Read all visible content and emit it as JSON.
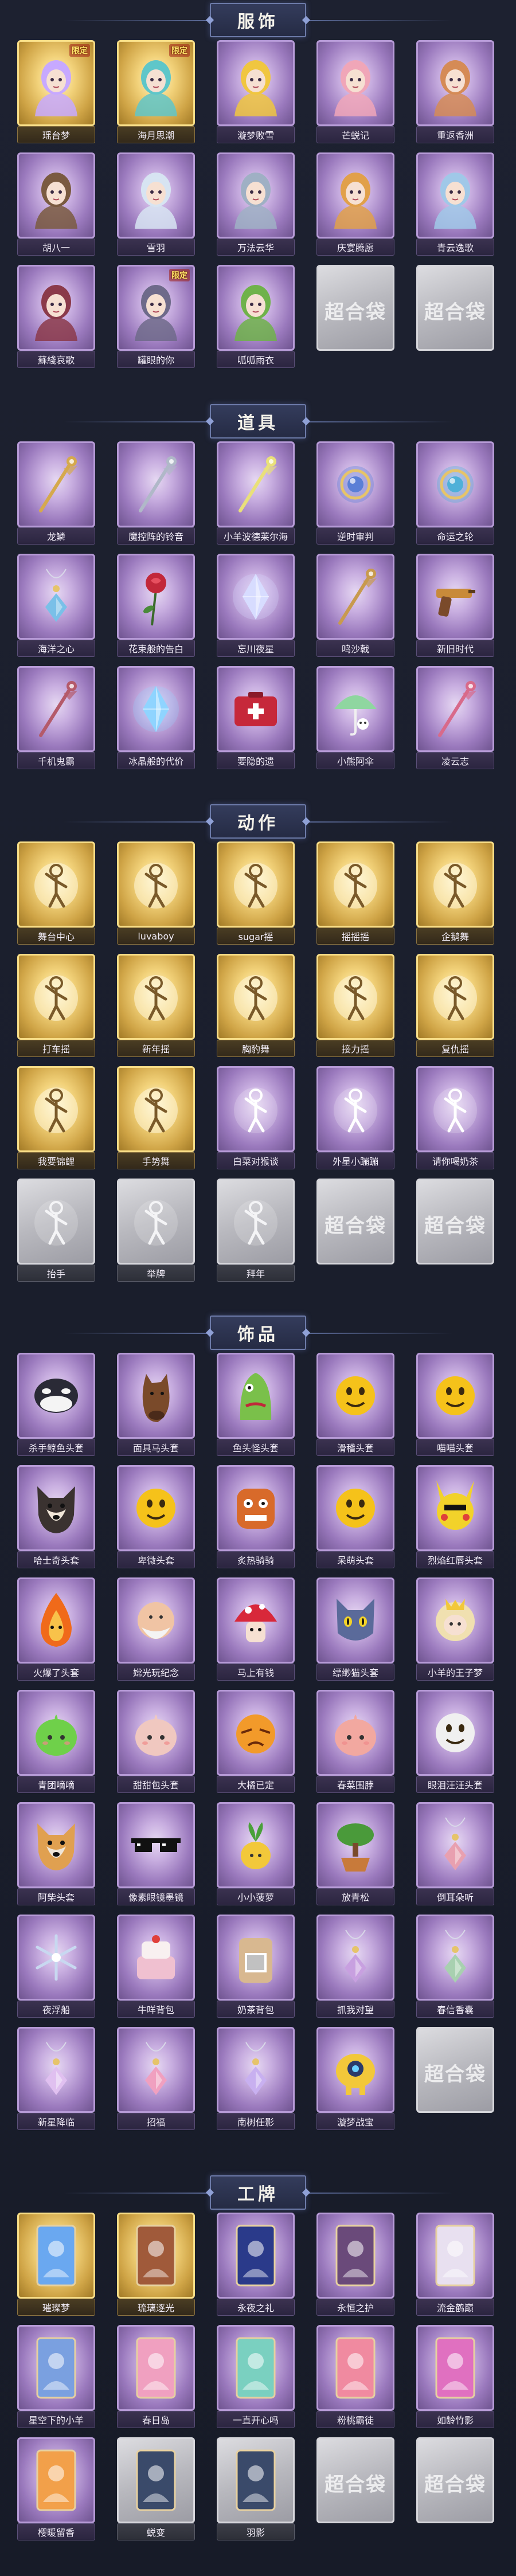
{
  "sections": [
    {
      "title": "服饰",
      "items": [
        {
          "label": "瑶台梦",
          "tier": "gold",
          "badge": "限定",
          "icon": "character-portrait-icon",
          "accent": "#c7a9ff"
        },
        {
          "label": "海月思潮",
          "tier": "gold",
          "badge": "限定",
          "icon": "character-portrait-icon",
          "accent": "#5fc6c9"
        },
        {
          "label": "漩梦败雪",
          "tier": "purple",
          "badge": "",
          "icon": "character-portrait-icon",
          "accent": "#f0c640"
        },
        {
          "label": "芒蜕记",
          "tier": "purple",
          "badge": "",
          "icon": "character-portrait-icon",
          "accent": "#f0a6b8"
        },
        {
          "label": "重返香洲",
          "tier": "purple",
          "badge": "",
          "icon": "character-portrait-icon",
          "accent": "#d58b56"
        },
        {
          "label": "胡八一",
          "tier": "purple",
          "badge": "",
          "icon": "character-portrait-icon",
          "accent": "#7a5a40"
        },
        {
          "label": "雪羽",
          "tier": "purple",
          "badge": "",
          "icon": "character-portrait-icon",
          "accent": "#d7e4f2"
        },
        {
          "label": "万法云华",
          "tier": "purple",
          "badge": "",
          "icon": "character-portrait-icon",
          "accent": "#9fb0c4"
        },
        {
          "label": "庆宴腾愿",
          "tier": "purple",
          "badge": "",
          "icon": "character-portrait-icon",
          "accent": "#e1a04a"
        },
        {
          "label": "青云逸歌",
          "tier": "purple",
          "badge": "",
          "icon": "character-portrait-icon",
          "accent": "#a0c8e8"
        },
        {
          "label": "蘇綫哀歌",
          "tier": "purple",
          "badge": "",
          "icon": "character-portrait-icon",
          "accent": "#8b3a4a"
        },
        {
          "label": "罐眼的你",
          "tier": "purple",
          "badge": "限定",
          "icon": "character-portrait-icon",
          "accent": "#6e6a8a"
        },
        {
          "label": "呱呱雨衣",
          "tier": "purple",
          "badge": "",
          "icon": "character-portrait-icon",
          "accent": "#6fb24a"
        },
        {
          "label": "",
          "tier": "gray",
          "badge": "",
          "icon": "empty-slot-icon",
          "accent": "#ffffff"
        },
        {
          "label": "",
          "tier": "gray",
          "badge": "",
          "icon": "empty-slot-icon",
          "accent": "#ffffff"
        }
      ]
    },
    {
      "title": "道具",
      "items": [
        {
          "label": "龙鳞",
          "tier": "purple",
          "badge": "",
          "icon": "staff-icon",
          "accent": "#d5a94d"
        },
        {
          "label": "魔控阵的铃音",
          "tier": "purple",
          "badge": "",
          "icon": "staff-icon",
          "accent": "#b0b8c8"
        },
        {
          "label": "小羊波德莱尔海",
          "tier": "purple",
          "badge": "",
          "icon": "staff-icon",
          "accent": "#e9e07a"
        },
        {
          "label": "逆时审判",
          "tier": "purple",
          "badge": "",
          "icon": "orb-icon",
          "accent": "#5a7fd6"
        },
        {
          "label": "命运之轮",
          "tier": "purple",
          "badge": "",
          "icon": "orb-icon",
          "accent": "#4fb0d8"
        },
        {
          "label": "海洋之心",
          "tier": "purple",
          "badge": "",
          "icon": "pendant-icon",
          "accent": "#7ac0e8"
        },
        {
          "label": "花束般的告白",
          "tier": "purple",
          "badge": "",
          "icon": "rose-icon",
          "accent": "#c2283a"
        },
        {
          "label": "忘川夜星",
          "tier": "purple",
          "badge": "",
          "icon": "crystal-icon",
          "accent": "#d7dcff"
        },
        {
          "label": "鸣沙戟",
          "tier": "purple",
          "badge": "",
          "icon": "staff-icon",
          "accent": "#c89a4e"
        },
        {
          "label": "新旧时代",
          "tier": "purple",
          "badge": "",
          "icon": "pistol-icon",
          "accent": "#c88a3a"
        },
        {
          "label": "千机鬼霸",
          "tier": "purple",
          "badge": "",
          "icon": "staff-icon",
          "accent": "#b45a6a"
        },
        {
          "label": "冰晶般的代价",
          "tier": "purple",
          "badge": "",
          "icon": "crystal-icon",
          "accent": "#8fd4ff"
        },
        {
          "label": "要隐的遗",
          "tier": "purple",
          "badge": "",
          "icon": "medkit-icon",
          "accent": "#c6283a"
        },
        {
          "label": "小熊阿伞",
          "tier": "purple",
          "badge": "",
          "icon": "umbrella-icon",
          "accent": "#8fd6a0"
        },
        {
          "label": "凌云志",
          "tier": "purple",
          "badge": "",
          "icon": "staff-icon",
          "accent": "#d86a8a"
        }
      ]
    },
    {
      "title": "动作",
      "items": [
        {
          "label": "舞台中心",
          "tier": "gold",
          "badge": "",
          "icon": "pose-figure-icon",
          "accent": "#7a5a2a"
        },
        {
          "label": "luvaboy",
          "tier": "gold",
          "badge": "",
          "icon": "pose-figure-icon",
          "accent": "#7a5a2a"
        },
        {
          "label": "sugar摇",
          "tier": "gold",
          "badge": "",
          "icon": "pose-figure-icon",
          "accent": "#7a5a2a"
        },
        {
          "label": "摇摇摇",
          "tier": "gold",
          "badge": "",
          "icon": "pose-figure-icon",
          "accent": "#7a5a2a"
        },
        {
          "label": "企鹅舞",
          "tier": "gold",
          "badge": "",
          "icon": "pose-figure-icon",
          "accent": "#7a5a2a"
        },
        {
          "label": "打车摇",
          "tier": "gold",
          "badge": "",
          "icon": "pose-figure-icon",
          "accent": "#7a5a2a"
        },
        {
          "label": "新年摇",
          "tier": "gold",
          "badge": "",
          "icon": "pose-figure-icon",
          "accent": "#7a5a2a"
        },
        {
          "label": "胸豹舞",
          "tier": "gold",
          "badge": "",
          "icon": "pose-figure-icon",
          "accent": "#7a5a2a"
        },
        {
          "label": "接力摇",
          "tier": "gold",
          "badge": "",
          "icon": "pose-figure-icon",
          "accent": "#7a5a2a"
        },
        {
          "label": "复仇摇",
          "tier": "gold",
          "badge": "",
          "icon": "pose-figure-icon",
          "accent": "#7a5a2a"
        },
        {
          "label": "我要锦鲤",
          "tier": "gold",
          "badge": "",
          "icon": "pose-figure-icon",
          "accent": "#7a5a2a"
        },
        {
          "label": "手势舞",
          "tier": "gold",
          "badge": "",
          "icon": "pose-figure-icon",
          "accent": "#7a5a2a"
        },
        {
          "label": "白菜对猴谈",
          "tier": "purple",
          "badge": "",
          "icon": "pose-figure-icon",
          "accent": "#ffffff"
        },
        {
          "label": "外星小蹦蹦",
          "tier": "purple",
          "badge": "",
          "icon": "pose-figure-icon",
          "accent": "#ffffff"
        },
        {
          "label": "请你喝奶茶",
          "tier": "purple",
          "badge": "",
          "icon": "pose-figure-icon",
          "accent": "#ffffff"
        },
        {
          "label": "抬手",
          "tier": "gray",
          "badge": "",
          "icon": "pose-figure-icon",
          "accent": "#ffffff"
        },
        {
          "label": "举牌",
          "tier": "gray",
          "badge": "",
          "icon": "pose-figure-icon",
          "accent": "#ffffff"
        },
        {
          "label": "拜年",
          "tier": "gray",
          "badge": "",
          "icon": "pose-figure-icon",
          "accent": "#ffffff"
        },
        {
          "label": "",
          "tier": "gray",
          "badge": "",
          "icon": "empty-slot-icon",
          "accent": "#ffffff"
        },
        {
          "label": "",
          "tier": "gray",
          "badge": "",
          "icon": "empty-slot-icon",
          "accent": "#ffffff"
        }
      ]
    },
    {
      "title": "饰品",
      "items": [
        {
          "label": "杀手鲸鱼头套",
          "tier": "purple",
          "badge": "",
          "icon": "orca-head-icon",
          "accent": "#2a2a36"
        },
        {
          "label": "面具马头套",
          "tier": "purple",
          "badge": "",
          "icon": "horse-head-icon",
          "accent": "#7a4a2a"
        },
        {
          "label": "鱼头怪头套",
          "tier": "purple",
          "badge": "",
          "icon": "fish-head-icon",
          "accent": "#7ac04a"
        },
        {
          "label": "滑稽头套",
          "tier": "purple",
          "badge": "",
          "icon": "emoji-head-icon",
          "accent": "#f5c21a"
        },
        {
          "label": "喵喵头套",
          "tier": "purple",
          "badge": "",
          "icon": "emoji-head-icon",
          "accent": "#f5c21a"
        },
        {
          "label": "哈士奇头套",
          "tier": "purple",
          "badge": "",
          "icon": "dog-head-icon",
          "accent": "#3a3230"
        },
        {
          "label": "卑微头套",
          "tier": "purple",
          "badge": "",
          "icon": "emoji-head-icon",
          "accent": "#f5c21a"
        },
        {
          "label": "炙热骑骑",
          "tier": "purple",
          "badge": "",
          "icon": "monster-head-icon",
          "accent": "#d86a2a"
        },
        {
          "label": "呆萌头套",
          "tier": "purple",
          "badge": "",
          "icon": "emoji-head-icon",
          "accent": "#f5c21a"
        },
        {
          "label": "烈焰红唇头套",
          "tier": "purple",
          "badge": "",
          "icon": "pikachu-head-icon",
          "accent": "#f2d22a"
        },
        {
          "label": "火爆了头套",
          "tier": "purple",
          "badge": "",
          "icon": "flame-head-icon",
          "accent": "#f06a1a"
        },
        {
          "label": "嫦光玩纪念",
          "tier": "purple",
          "badge": "",
          "icon": "elder-head-icon",
          "accent": "#f0c4a4"
        },
        {
          "label": "马上有钱",
          "tier": "purple",
          "badge": "",
          "icon": "mushroom-head-icon",
          "accent": "#d8283a"
        },
        {
          "label": "缥缈猫头套",
          "tier": "purple",
          "badge": "",
          "icon": "cat-head-icon",
          "accent": "#5a6a9a"
        },
        {
          "label": "小羊的王子梦",
          "tier": "purple",
          "badge": "",
          "icon": "sheep-head-icon",
          "accent": "#f0e0b0"
        },
        {
          "label": "青团嘀嘀",
          "tier": "purple",
          "badge": "",
          "icon": "bun-head-icon",
          "accent": "#6fd04a"
        },
        {
          "label": "甜甜包头套",
          "tier": "purple",
          "badge": "",
          "icon": "bun-head-icon",
          "accent": "#f0c8c0"
        },
        {
          "label": "大橘已定",
          "tier": "purple",
          "badge": "",
          "icon": "orange-head-icon",
          "accent": "#f29a2a"
        },
        {
          "label": "春菜围脖",
          "tier": "purple",
          "badge": "",
          "icon": "bun-head-icon",
          "accent": "#f2a8a0"
        },
        {
          "label": "眼泪汪汪头套",
          "tier": "purple",
          "badge": "",
          "icon": "emoji-head-icon",
          "accent": "#f0f0f0"
        },
        {
          "label": "阿柴头套",
          "tier": "purple",
          "badge": "",
          "icon": "dog-head-icon",
          "accent": "#e0a050"
        },
        {
          "label": "像素眼镜墨镜",
          "tier": "purple",
          "badge": "",
          "icon": "sunglasses-icon",
          "accent": "#111111"
        },
        {
          "label": "小小菠萝",
          "tier": "purple",
          "badge": "",
          "icon": "sprout-icon",
          "accent": "#f2c83a"
        },
        {
          "label": "放青松",
          "tier": "purple",
          "badge": "",
          "icon": "bonsai-icon",
          "accent": "#4a9a3a"
        },
        {
          "label": "倒耳朵听",
          "tier": "purple",
          "badge": "",
          "icon": "pendant-icon",
          "accent": "#e8a0b0"
        },
        {
          "label": "夜浮船",
          "tier": "purple",
          "badge": "",
          "icon": "snowflake-icon",
          "accent": "#c8d8f0"
        },
        {
          "label": "牛咩背包",
          "tier": "purple",
          "badge": "",
          "icon": "cake-icon",
          "accent": "#f0c0d0"
        },
        {
          "label": "奶茶背包",
          "tier": "purple",
          "badge": "",
          "icon": "tea-bag-icon",
          "accent": "#d8b890"
        },
        {
          "label": "抓我对望",
          "tier": "purple",
          "badge": "",
          "icon": "pendant-icon",
          "accent": "#c8a0e0"
        },
        {
          "label": "春信香囊",
          "tier": "purple",
          "badge": "",
          "icon": "pendant-icon",
          "accent": "#a8d0b0"
        },
        {
          "label": "新星降临",
          "tier": "purple",
          "badge": "",
          "icon": "pendant-icon",
          "accent": "#e0c0f0"
        },
        {
          "label": "招福",
          "tier": "purple",
          "badge": "",
          "icon": "pendant-icon",
          "accent": "#f0a0c0"
        },
        {
          "label": "南树任影",
          "tier": "purple",
          "badge": "",
          "icon": "pendant-icon",
          "accent": "#c8b0f0"
        },
        {
          "label": "漩梦战宝",
          "tier": "purple",
          "badge": "",
          "icon": "robot-icon",
          "accent": "#f2c83a"
        },
        {
          "label": "",
          "tier": "gray",
          "badge": "",
          "icon": "empty-slot-icon",
          "accent": "#ffffff"
        }
      ]
    },
    {
      "title": "工牌",
      "items": [
        {
          "label": "璀璨梦",
          "tier": "gold",
          "badge": "",
          "icon": "badge-card-icon",
          "accent": "#6aa8f0"
        },
        {
          "label": "琉璃逐光",
          "tier": "gold",
          "badge": "",
          "icon": "badge-card-icon",
          "accent": "#a05a3a"
        },
        {
          "label": "永夜之礼",
          "tier": "purple",
          "badge": "",
          "icon": "badge-card-icon",
          "accent": "#2a3a8a"
        },
        {
          "label": "永恒之护",
          "tier": "purple",
          "badge": "",
          "icon": "badge-card-icon",
          "accent": "#6a4a7a"
        },
        {
          "label": "流金鹤巅",
          "tier": "purple",
          "badge": "",
          "icon": "badge-card-icon",
          "accent": "#e8e0f0"
        },
        {
          "label": "星空下的小羊",
          "tier": "purple",
          "badge": "",
          "icon": "badge-card-icon",
          "accent": "#7aa0e0"
        },
        {
          "label": "春日岛",
          "tier": "purple",
          "badge": "",
          "icon": "badge-card-icon",
          "accent": "#f0a0c0"
        },
        {
          "label": "一直开心吗",
          "tier": "purple",
          "badge": "",
          "icon": "badge-card-icon",
          "accent": "#7ad0c0"
        },
        {
          "label": "粉桃霸徒",
          "tier": "purple",
          "badge": "",
          "icon": "badge-card-icon",
          "accent": "#f08aa0"
        },
        {
          "label": "如龄竹影",
          "tier": "purple",
          "badge": "",
          "icon": "badge-card-icon",
          "accent": "#e070c0"
        },
        {
          "label": "樱暖留香",
          "tier": "purple",
          "badge": "",
          "icon": "badge-card-icon",
          "accent": "#f2a04a"
        },
        {
          "label": "蜕变",
          "tier": "gray",
          "badge": "",
          "icon": "badge-card-icon",
          "accent": "#3a4a6a"
        },
        {
          "label": "羽影",
          "tier": "gray",
          "badge": "",
          "icon": "badge-card-icon",
          "accent": "#3a4a6a"
        },
        {
          "label": "",
          "tier": "gray",
          "badge": "",
          "icon": "empty-slot-icon",
          "accent": "#ffffff"
        },
        {
          "label": "",
          "tier": "gray",
          "badge": "",
          "icon": "empty-slot-icon",
          "accent": "#ffffff"
        }
      ]
    }
  ],
  "empty_slot_mark": "超合袋",
  "colors": {
    "background": "#1b1f2d",
    "purple_card": "#9a79bd",
    "gold_card": "#cfa446",
    "gray_card": "#b8b8be",
    "header_plate": "#2c3350"
  }
}
